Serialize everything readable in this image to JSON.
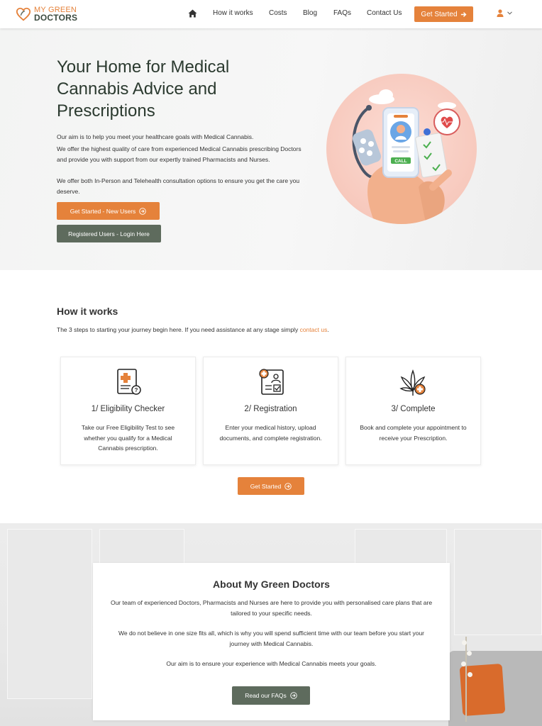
{
  "header": {
    "logo_line1": "MY GREEN",
    "logo_line2": "DOCTORS",
    "nav": [
      "How it works",
      "Costs",
      "Blog",
      "FAQs",
      "Contact Us"
    ],
    "get_started": "Get Started"
  },
  "hero": {
    "title": "Your Home for Medical Cannabis Advice and Prescriptions",
    "p1": "Our aim is to help you meet your healthcare goals with Medical Cannabis.",
    "p2": "We offer the highest quality of care from experienced Medical Cannabis prescribing Doctors and provide you with support from our expertly trained Pharmacists and Nurses.",
    "p3": "We offer both In-Person and Telehealth consultation options to ensure you get the care you deserve.",
    "btn_new": "Get Started - New Users",
    "btn_login": "Registered Users - Login Here",
    "illustration_call": "CALL"
  },
  "how": {
    "title": "How it works",
    "subtitle": "The 3 steps to starting your journey begin here. If you need assistance at any stage simply",
    "link": "contact us",
    "subtitle_end": ".",
    "cards": [
      {
        "title": "1/ Eligibility Checker",
        "text": "Take our Free Eligibility Test to see whether you qualify for a Medical Cannabis prescription.",
        "icon": "eligibility-document-icon"
      },
      {
        "title": "2/ Registration",
        "text": "Enter your medical history, upload documents, and complete registration.",
        "icon": "registration-form-icon"
      },
      {
        "title": "3/ Complete",
        "text": "Book and complete your appointment to receive your Prescription.",
        "icon": "cannabis-leaf-icon"
      }
    ],
    "get_started": "Get Started"
  },
  "about": {
    "title": "About My Green Doctors",
    "p1": "Our team of experienced Doctors, Pharmacists and Nurses are here to provide you with personalised care plans that are tailored to your specific needs.",
    "p2": "We do not believe in one size fits all, which is why you will spend sufficient time with our team before you start your journey with Medical Cannabis.",
    "p3": "Our aim is to ensure your experience with Medical Cannabis meets your goals.",
    "btn": "Read our FAQs"
  },
  "colors": {
    "accent": "#e5823b",
    "green": "#5e6b5d",
    "heading": "#2b3a2f"
  }
}
